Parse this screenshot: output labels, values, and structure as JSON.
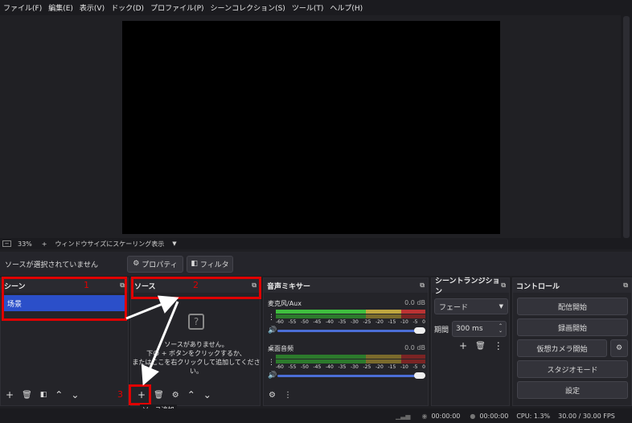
{
  "menu": [
    "ファイル(F)",
    "編集(E)",
    "表示(V)",
    "ドック(D)",
    "プロファイル(P)",
    "シーンコレクション(S)",
    "ツール(T)",
    "ヘルプ(H)"
  ],
  "preview": {
    "zoom": "33%",
    "scale_mode": "ウィンドウサイズにスケーリング表示"
  },
  "source_bar": {
    "none_selected": "ソースが選択されていません",
    "properties": "プロパティ",
    "filters": "フィルタ"
  },
  "scenes": {
    "title": "シーン",
    "items": [
      "场景"
    ],
    "annotation": "1"
  },
  "sources": {
    "title": "ソース",
    "annotation": "2",
    "empty_line1": "ソースがありません。",
    "empty_line2": "下の + ボタンをクリックするか、",
    "empty_line3": "またはここを右クリックして追加してください。",
    "add_annotation": "3",
    "tooltip": "ソース追加"
  },
  "mixer": {
    "title": "音声ミキサー",
    "channels": [
      {
        "name": "麦克风/Aux",
        "level": "0.0 dB"
      },
      {
        "name": "桌面音频",
        "level": "0.0 dB"
      }
    ],
    "ticks": [
      "-60",
      "-55",
      "-50",
      "-45",
      "-40",
      "-35",
      "-30",
      "-25",
      "-20",
      "-15",
      "-10",
      "-5",
      "0"
    ]
  },
  "transitions": {
    "title": "シーントランジション",
    "selected": "フェード",
    "duration_label": "期間",
    "duration": "300 ms"
  },
  "controls": {
    "title": "コントロール",
    "buttons": [
      "配信開始",
      "録画開始",
      "仮想カメラ開始",
      "スタジオモード",
      "設定"
    ]
  },
  "status": {
    "stream_time": "00:00:00",
    "rec_time": "00:00:00",
    "cpu": "CPU: 1.3%",
    "fps": "30.00 / 30.00 FPS"
  }
}
